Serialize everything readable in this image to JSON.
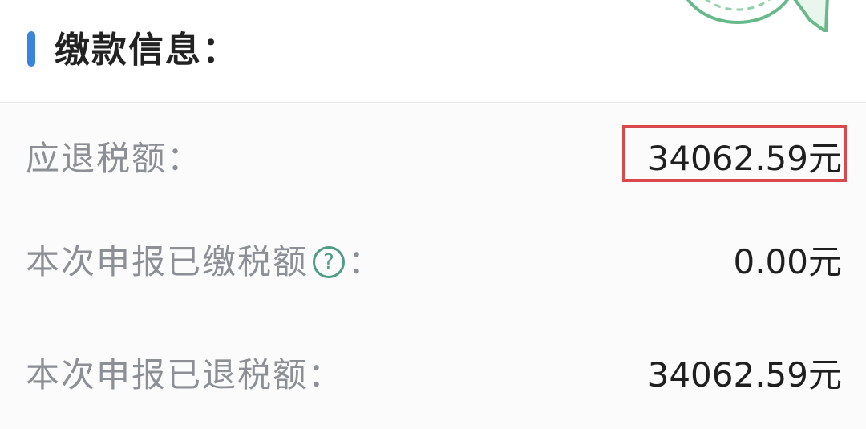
{
  "section": {
    "title": "缴款信息："
  },
  "rows": [
    {
      "label": "应退税额：",
      "value": "34062.59元"
    },
    {
      "label": "本次申报已缴税额",
      "label_suffix": "：",
      "value": "0.00元"
    },
    {
      "label": "本次申报已退税额：",
      "value": "34062.59元"
    }
  ],
  "icons": {
    "help": "?"
  },
  "colors": {
    "accent": "#3a84d9",
    "highlight": "#d8484d",
    "icon": "#4e9c86",
    "label": "#8c8f94",
    "value": "#1f1f1f"
  }
}
